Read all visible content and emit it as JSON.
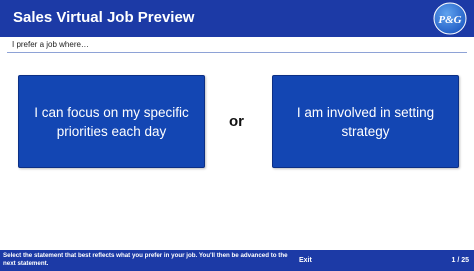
{
  "header": {
    "title": "Sales Virtual Job Preview",
    "logo_text": "P&G"
  },
  "prompt": {
    "text": "I prefer a job where…"
  },
  "choices": [
    {
      "label": "I can focus on my specific priorities each day"
    },
    {
      "label": "I am involved in setting strategy"
    }
  ],
  "separator": "or",
  "footer": {
    "instruction": "Select the statement that best reflects what you prefer in your job. You'll then be advanced to the next statement.",
    "exit_label": "Exit",
    "page_counter": "1 / 25"
  },
  "colors": {
    "header_bg": "#1c3aa6",
    "choice_bg": "#1346b3",
    "logo_blue": "#2a6fd1"
  }
}
